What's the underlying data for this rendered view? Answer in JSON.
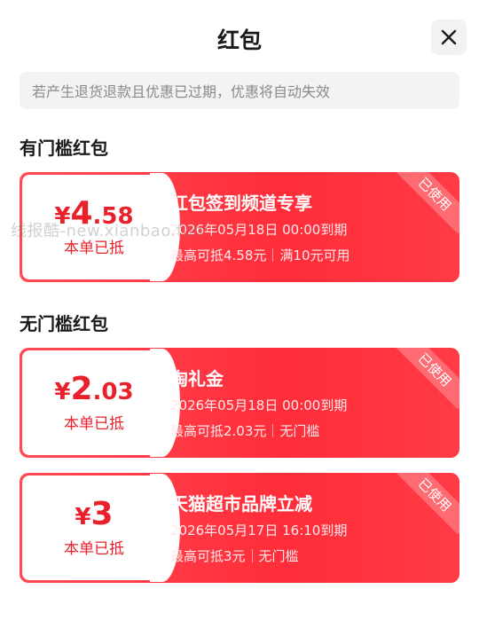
{
  "header": {
    "title": "红包",
    "close_icon": "close-icon"
  },
  "notice": "若产生退货退款且优惠已过期，优惠将自动失效",
  "sections": [
    {
      "title": "有门槛红包",
      "coupons": [
        {
          "currency": "¥",
          "amount_int": "4",
          "amount_dec": ".58",
          "deduct_label": "本单已抵",
          "name": "红包签到频道专享",
          "expire": "2026年05月18日 00:00到期",
          "max_deduct": "最高可抵4.58元",
          "threshold": "满10元可用",
          "status": "已使用"
        }
      ]
    },
    {
      "title": "无门槛红包",
      "coupons": [
        {
          "currency": "¥",
          "amount_int": "2",
          "amount_dec": ".03",
          "deduct_label": "本单已抵",
          "name": "淘礼金",
          "expire": "2026年05月18日 00:00到期",
          "max_deduct": "最高可抵2.03元",
          "threshold": "无门槛",
          "status": "已使用"
        },
        {
          "currency": "¥",
          "amount_int": "3",
          "amount_dec": "",
          "deduct_label": "本单已抵",
          "name": "天猫超市品牌立减",
          "expire": "2026年05月17日 16:10到期",
          "max_deduct": "最高可抵3元",
          "threshold": "无门槛",
          "status": "已使用"
        }
      ]
    }
  ],
  "watermark": "线报酷-new.xianbao.fun",
  "colors": {
    "accent": "#e8212b",
    "card_bg": "#ff3b45",
    "notice_bg": "#f2f3f5"
  }
}
